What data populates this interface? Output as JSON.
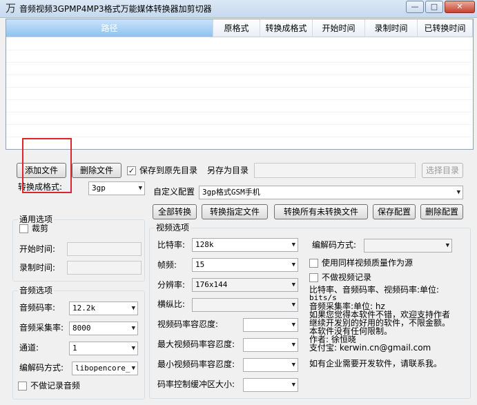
{
  "window": {
    "title": "音频视频3GPMP4MP3格式万能媒体转换器加剪切器",
    "app_icon": "万",
    "min_glyph": "—",
    "max_glyph": "□",
    "close_glyph": "✕"
  },
  "table": {
    "columns": [
      "路径",
      "原格式",
      "转换成格式",
      "开始时间",
      "录制时间",
      "已转换时间"
    ]
  },
  "toolbar": {
    "add_file": "添加文件",
    "delete_file": "删除文件",
    "save_to_source_label": "保存到原先目录",
    "save_as_label": "另存为目录",
    "save_as_path": "",
    "choose_dir": "选择目录",
    "convert_format_label": "转换成格式:",
    "convert_format_value": "3gp",
    "custom_config_label": "自定义配置",
    "custom_config_value": "3gp格式GSM手机",
    "convert_all": "全部转换",
    "convert_selected": "转换指定文件",
    "convert_remaining": "转换所有未转换文件",
    "save_config": "保存配置",
    "delete_config": "删除配置"
  },
  "general": {
    "title": "通用选项",
    "cut_label": "裁剪",
    "start_time_label": "开始时间:",
    "record_time_label": "录制时间:"
  },
  "audio": {
    "title": "音频选项",
    "bitrate_label": "音频码率:",
    "bitrate_value": "12.2k",
    "samplerate_label": "音频采集率:",
    "samplerate_value": "8000",
    "channels_label": "通道:",
    "channels_value": "1",
    "codec_label": "编解码方式:",
    "codec_value": "libopencore_",
    "no_audio_label": "不做记录音频"
  },
  "video": {
    "title": "视频选项",
    "bitrate_label": "比特率:",
    "bitrate_value": "128k",
    "fps_label": "帧频:",
    "fps_value": "15",
    "resolution_label": "分辨率:",
    "resolution_value": "176x144",
    "aspect_label": "横纵比:",
    "aspect_value": "",
    "bitrate_tolerance_label": "视频码率容忍度:",
    "max_bitrate_tolerance_label": "最大视频码率容忍度:",
    "min_bitrate_tolerance_label": "最小视频码率容忍度:",
    "buffer_size_label": "码率控制缓冲区大小:",
    "codec_label": "编解码方式:",
    "codec_value": "",
    "same_quality_label": "使用同样视频质量作为源",
    "no_video_label": "不做视频记录"
  },
  "info": {
    "line1": "比特率、音频码率、视频码率:单位:",
    "line2": "bits/s",
    "line3": "音频采集率:单位: hz",
    "line4": "如果您觉得本软件不错，欢迎支持作者",
    "line5": "继续开发别的好用的软件，不限金额。",
    "line6": "本软件没有任何限制。",
    "line7": "作者: 徐恒晓",
    "line8": "支付宝: kerwin.cn@gmail.com",
    "line9": "如有企业需要开发软件，请联系我。"
  },
  "checks": {
    "checked_glyph": "✓"
  },
  "combo_arrow": "▼"
}
